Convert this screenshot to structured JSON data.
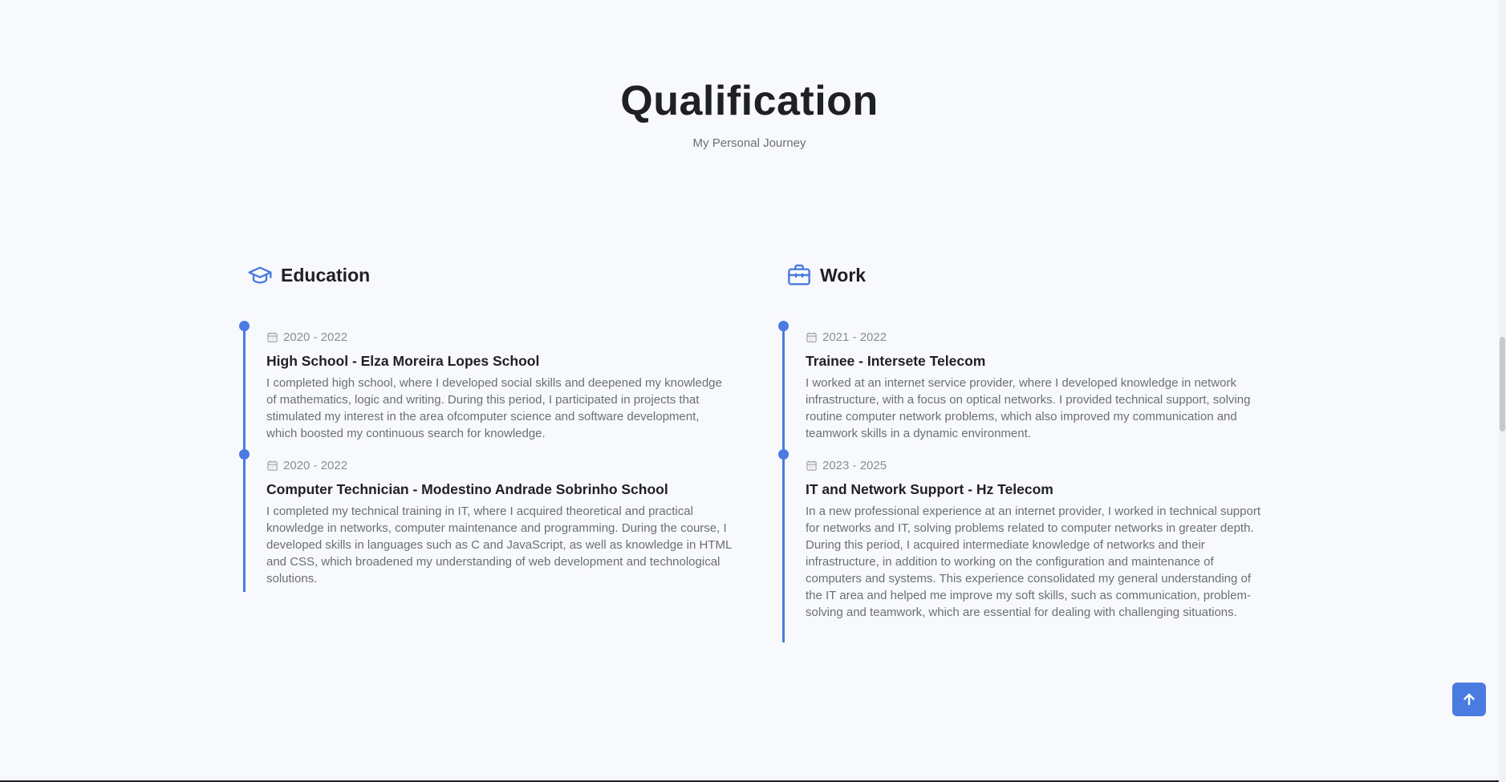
{
  "qualification": {
    "title": "Qualification",
    "subtitle": "My Personal Journey"
  },
  "education": {
    "heading": "Education",
    "icon": "graduation-cap-icon",
    "items": [
      {
        "date": "2020 - 2022",
        "title": "High School - Elza Moreira Lopes School",
        "description": "I completed high school, where I developed social skills and deepened my knowledge of mathematics, logic and writing. During this period, I participated in projects that stimulated my interest in the area ofcomputer science and software development, which boosted my continuous search for knowledge."
      },
      {
        "date": "2020 - 2022",
        "title": "Computer Technician - Modestino Andrade Sobrinho School",
        "description": "I completed my technical training in IT, where I acquired theoretical and practical knowledge in networks, computer maintenance and programming. During the course, I developed skills in languages such as C and JavaScript, as well as knowledge in HTML and CSS, which broadened my understanding of web development and technological solutions."
      }
    ]
  },
  "work": {
    "heading": "Work",
    "icon": "briefcase-icon",
    "items": [
      {
        "date": "2021 - 2022",
        "title": "Trainee - Intersete Telecom",
        "description": "I worked at an internet service provider, where I developed knowledge in network infrastructure, with a focus on optical networks. I provided technical support, solving routine computer network problems, which also improved my communication and teamwork skills in a dynamic environment."
      },
      {
        "date": "2023 - 2025",
        "title": "IT and Network Support - Hz Telecom",
        "description": "In a new professional experience at an internet provider, I worked in technical support for networks and IT, solving problems related to computer networks in greater depth. During this period, I acquired intermediate knowledge of networks and their infrastructure, in addition to working on the configuration and maintenance of computers and systems. This experience consolidated my general understanding of the IT area and helped me improve my soft skills, such as communication, problem-solving and teamwork, which are essential for dealing with challenging situations."
      }
    ]
  },
  "colors": {
    "accent": "#4a7be0",
    "title": "#1f2024",
    "muted": "#6b6e75",
    "background": "#f8f9fc"
  },
  "back_to_top": {
    "icon": "arrow-up-icon"
  }
}
